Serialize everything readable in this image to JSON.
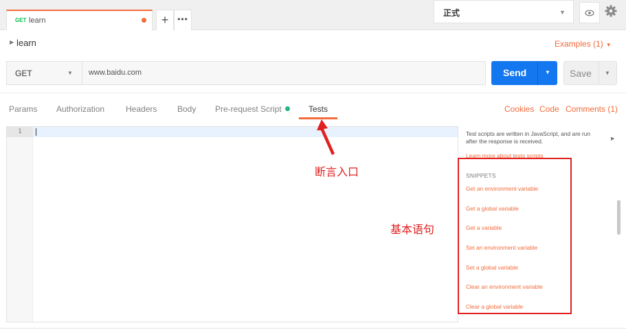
{
  "tabs": {
    "active": {
      "method": "GET",
      "name": "learn"
    },
    "new_tab": "+",
    "more": "•••"
  },
  "environment": {
    "selected": "正式"
  },
  "request": {
    "name": "learn",
    "examples_label": "Examples (1)",
    "method": "GET",
    "url": "www.baidu.com"
  },
  "buttons": {
    "send": "Send",
    "save": "Save"
  },
  "subtabs": [
    "Params",
    "Authorization",
    "Headers",
    "Body",
    "Pre-request Script",
    "Tests"
  ],
  "right_links": {
    "cookies": "Cookies",
    "code": "Code",
    "comments": "Comments (1)"
  },
  "editor": {
    "line_number": "1"
  },
  "sidebar": {
    "description": "Test scripts are written in JavaScript, and are run after the response is received.",
    "learn_more": "Learn more about tests scripts",
    "snippets_title": "SNIPPETS",
    "snippets": [
      "Get an environment variable",
      "Get a global variable",
      "Get a variable",
      "Set an environment variable",
      "Set a global variable",
      "Clear an environment variable",
      "Clear a global variable"
    ]
  },
  "annotations": {
    "assertion_entry": "断言入口",
    "basic_statements": "基本语句"
  },
  "colors": {
    "accent": "#f26b3a",
    "send": "#1378f0",
    "annotation": "#e02020",
    "get_method": "#0cbb52"
  }
}
